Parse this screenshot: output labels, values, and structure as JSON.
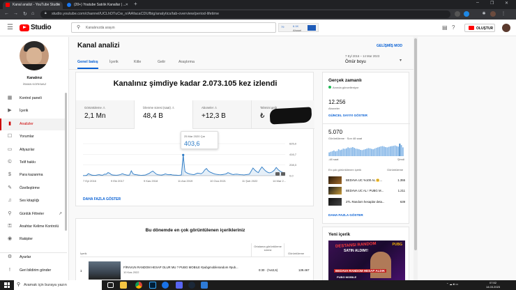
{
  "browser": {
    "tabs": [
      {
        "label": "Kanal analizi - YouTube Studio",
        "active": true
      },
      {
        "label": "(20+) Youtube Satılık Kanallar | ...",
        "active": false
      }
    ],
    "url": "studio.youtube.com/channel/UCLhDTuCw_n/AAfacaCDUfbig/analytics/tab-overview/period-lifetime"
  },
  "header": {
    "logo_text": "Studio",
    "search_placeholder": "Kanalınızda arayın",
    "extension": {
      "a": "79",
      "b": "6.1K",
      "c": "Ahusei"
    },
    "create_label": "OLUŞTUR"
  },
  "sidebar": {
    "channel_name": "Kanalınız",
    "channel_sub": "İSMAN KORKMAZ",
    "items": [
      {
        "label": "Kontrol paneli",
        "icon": "dashboard-icon",
        "glyph": "▦"
      },
      {
        "label": "İçerik",
        "icon": "content-icon",
        "glyph": "▶"
      },
      {
        "label": "Analizler",
        "icon": "analytics-icon",
        "glyph": "▮",
        "active": true
      },
      {
        "label": "Yorumlar",
        "icon": "comments-icon",
        "glyph": "☐"
      },
      {
        "label": "Altyazılar",
        "icon": "subtitles-icon",
        "glyph": "▭"
      },
      {
        "label": "Telif hakkı",
        "icon": "copyright-icon",
        "glyph": "©"
      },
      {
        "label": "Para kazanma",
        "icon": "monetization-icon",
        "glyph": "$"
      },
      {
        "label": "Özelleştirme",
        "icon": "customization-icon",
        "glyph": "✎"
      },
      {
        "label": "Ses kitaplığı",
        "icon": "audio-library-icon",
        "glyph": "♫"
      },
      {
        "label": "Günlük Filtreler",
        "icon": "daily-filters-icon",
        "glyph": "⚲"
      },
      {
        "label": "Anahtar Kelime Kontrolü",
        "icon": "keyword-icon",
        "glyph": "⚿"
      },
      {
        "label": "Rakipler",
        "icon": "competitors-icon",
        "glyph": "◉"
      }
    ],
    "bottom_items": [
      {
        "label": "Ayarlar",
        "icon": "settings-icon",
        "glyph": "⚙"
      },
      {
        "label": "Geri bildirim gönder",
        "icon": "feedback-icon",
        "glyph": "!"
      }
    ]
  },
  "page": {
    "title": "Kanal analizi",
    "tabs": [
      "Genel bakış",
      "İçerik",
      "Kitle",
      "Gelir",
      "Araştırma"
    ],
    "advanced_mode": "GELİŞMİŞ MOD",
    "date_range": "7 Eyl 2016 – 14 Mar 2023",
    "date_period": "Ömür boyu"
  },
  "summary": {
    "headline": "Kanalınız şimdiye kadar 2.073.105 kez izlendi",
    "metrics": [
      {
        "label": "Görüntüleme",
        "value": "2,1 Mn"
      },
      {
        "label": "İzlenme süresi (saat)",
        "value": "48,4 B"
      },
      {
        "label": "Aboneler",
        "value": "+12,3 B"
      },
      {
        "label": "Tahmini gelir",
        "value": "₺"
      }
    ],
    "tooltip_date": "25 Mar 2020 Çar",
    "tooltip_value": "403,6",
    "more_link": "DAHA FAZLA GÖSTER"
  },
  "chart_data": {
    "type": "line",
    "title": "",
    "xlabel": "",
    "ylabel": "",
    "x_ticks": [
      "7 Eyl 2016",
      "9 Eki 2017",
      "9 Kas 2018",
      "11 Ara 2019",
      "10 Oca 2021",
      "11 Şub 2022",
      "14 Mar 2..."
    ],
    "y_ticks": [
      "625,0",
      "416,7",
      "208,3",
      "0,0"
    ],
    "ylim": [
      0,
      625
    ],
    "series": [
      {
        "values": [
          2,
          3,
          5,
          40,
          25,
          10,
          8,
          6,
          15,
          20,
          12,
          9,
          30,
          28,
          60,
          45,
          18,
          12,
          10,
          9,
          14,
          22,
          40,
          25,
          16,
          10,
          12,
          95,
          35,
          22,
          18,
          12,
          9,
          8,
          10,
          14,
          30,
          45,
          70,
          90,
          60,
          30,
          18,
          14,
          12,
          20,
          35,
          25,
          18,
          22,
          15,
          12,
          10,
          8,
          9,
          14,
          403.6,
          80,
          55,
          40,
          30,
          25,
          20,
          35,
          50,
          45,
          38,
          60,
          110,
          140,
          95,
          70,
          55,
          40,
          30,
          25,
          20,
          18,
          22,
          28,
          35,
          60,
          45,
          30,
          22,
          28,
          30,
          25,
          20,
          18,
          15,
          20,
          25,
          30,
          90,
          150,
          110,
          80,
          60,
          120,
          170,
          130,
          95,
          70,
          55,
          60,
          80,
          110,
          160,
          120,
          90,
          70,
          60,
          50
        ]
      }
    ],
    "grid": true,
    "color": "#2a79c4"
  },
  "realtime": {
    "title": "Gerçek zamanlı",
    "live_label": "Anında güncelleniyor",
    "subscribers": "12.256",
    "subscribers_label": "Aboneler",
    "see_subs": "GÜNCEL SAYIYI GÖSTER",
    "views": "5.070",
    "views_label": "Görüntüleme · Son 48 saat",
    "bars": [
      30,
      35,
      40,
      45,
      38,
      42,
      55,
      48,
      52,
      60,
      58,
      62,
      70,
      65,
      68,
      72,
      66,
      60,
      58,
      55,
      50,
      48,
      52,
      56,
      60,
      64,
      62,
      58,
      55,
      60,
      66,
      70,
      74,
      78,
      80,
      76,
      72,
      70,
      74,
      78,
      80,
      82,
      85,
      80,
      76,
      100,
      88,
      70
    ],
    "axis_left": "-48 saat",
    "axis_right": "Şimdi",
    "top_header": "En çok görüntülenen içerik",
    "top_header_right": "Görüntüleme",
    "top": [
      {
        "title": "BEDAVA UC %100 AL 🤗...",
        "views": "1.355"
      },
      {
        "title": "BEDAVA UC AL ! PUBG M...",
        "views": "1.211"
      },
      {
        "title": "2TL Random hesaplar deta...",
        "views": "639"
      }
    ],
    "see_more": "DAHA FAZLA GÖSTER"
  },
  "new_content": {
    "title": "Yeni içerik",
    "thumb_line1": "DESTANSI RANDOM",
    "thumb_line2": "SATIN ALDIM!!",
    "thumb_line3": "BEDAVA RANDOM HESAP ALDIK",
    "thumb_line4": "PUBG MOBILE",
    "thumb_brand": "PUBG"
  },
  "top_content": {
    "heading": "Bu dönemde en çok görüntülenen içerikleriniz",
    "col_content": "İçerik",
    "col_duration": "Ortalama görüntüleme süresi",
    "col_views": "Görüntüleme",
    "rows": [
      {
        "rank": "1",
        "title": "FİRAVUN RANDOM HESAP OLUR MU ? PUBG MOBILE #pubgmobilerandom #pub...",
        "date": "10 Kas 2022",
        "duration": "0:30 · (%42,6)",
        "views": "139.467"
      }
    ]
  },
  "taskbar": {
    "search_label": "Aramak için buraya yazın",
    "time": "07:52",
    "date": "14.03.2023"
  }
}
